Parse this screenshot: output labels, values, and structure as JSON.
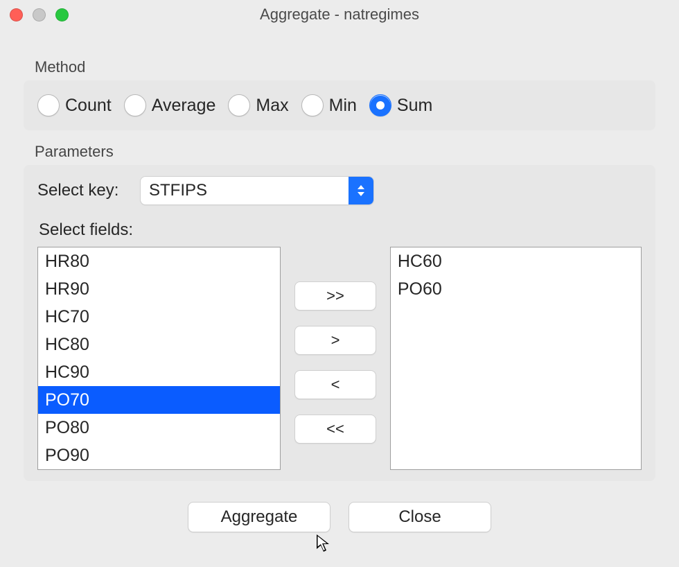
{
  "window": {
    "title": "Aggregate - natregimes"
  },
  "method": {
    "label": "Method",
    "options": [
      {
        "label": "Count",
        "selected": false
      },
      {
        "label": "Average",
        "selected": false
      },
      {
        "label": "Max",
        "selected": false
      },
      {
        "label": "Min",
        "selected": false
      },
      {
        "label": "Sum",
        "selected": true
      }
    ]
  },
  "params": {
    "label": "Parameters",
    "select_key_label": "Select key:",
    "select_key_value": "STFIPS",
    "select_fields_label": "Select fields:",
    "available": [
      {
        "label": "HR80",
        "selected": false
      },
      {
        "label": "HR90",
        "selected": false
      },
      {
        "label": "HC70",
        "selected": false
      },
      {
        "label": "HC80",
        "selected": false
      },
      {
        "label": "HC90",
        "selected": false
      },
      {
        "label": "PO70",
        "selected": true
      },
      {
        "label": "PO80",
        "selected": false
      },
      {
        "label": "PO90",
        "selected": false
      }
    ],
    "chosen": [
      {
        "label": "HC60"
      },
      {
        "label": "PO60"
      }
    ],
    "buttons": {
      "move_all_right": ">>",
      "move_right": ">",
      "move_left": "<",
      "move_all_left": "<<"
    }
  },
  "footer": {
    "aggregate": "Aggregate",
    "close": "Close"
  }
}
